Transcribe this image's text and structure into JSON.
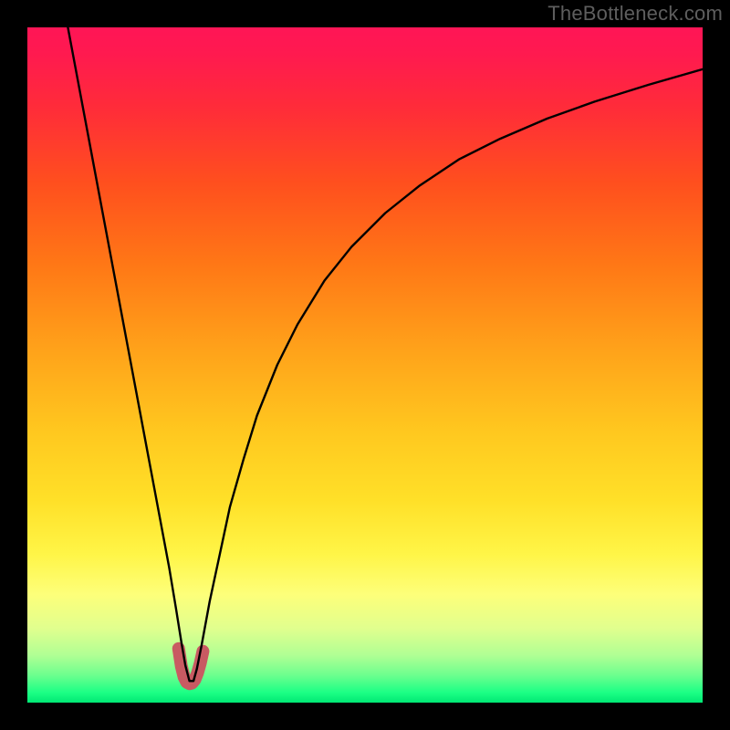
{
  "watermark": "TheBottleneck.com",
  "chart_data": {
    "type": "line",
    "title": "",
    "xlabel": "",
    "ylabel": "",
    "xlim": [
      0,
      100
    ],
    "ylim": [
      0,
      100
    ],
    "grid": false,
    "legend": null,
    "background_gradient_stops": [
      {
        "offset": 0.0,
        "color": "#ff1556"
      },
      {
        "offset": 0.04,
        "color": "#ff1a4f"
      },
      {
        "offset": 0.12,
        "color": "#ff2c39"
      },
      {
        "offset": 0.23,
        "color": "#ff4f1e"
      },
      {
        "offset": 0.35,
        "color": "#ff7716"
      },
      {
        "offset": 0.48,
        "color": "#ffa31a"
      },
      {
        "offset": 0.6,
        "color": "#ffc81f"
      },
      {
        "offset": 0.7,
        "color": "#ffe028"
      },
      {
        "offset": 0.78,
        "color": "#fff547"
      },
      {
        "offset": 0.84,
        "color": "#fdff7a"
      },
      {
        "offset": 0.89,
        "color": "#e1ff8e"
      },
      {
        "offset": 0.93,
        "color": "#b0ff94"
      },
      {
        "offset": 0.96,
        "color": "#6bff8e"
      },
      {
        "offset": 0.985,
        "color": "#1cff85"
      },
      {
        "offset": 1.0,
        "color": "#00e874"
      }
    ],
    "primary_curve_x": [
      6.0,
      7.5,
      9.0,
      10.5,
      12.0,
      13.5,
      15.0,
      16.5,
      18.0,
      19.5,
      21.0,
      22.0,
      22.8,
      23.4,
      24.0,
      24.6,
      25.1,
      25.8,
      27.0,
      28.5,
      30.0,
      32.0,
      34.0,
      37.0,
      40.0,
      44.0,
      48.0,
      53.0,
      58.0,
      64.0,
      70.0,
      77.0,
      84.0,
      92.0,
      100.0
    ],
    "primary_curve_y": [
      100.0,
      92.0,
      84.0,
      76.0,
      68.0,
      60.0,
      52.0,
      44.0,
      36.0,
      28.0,
      20.0,
      14.0,
      9.0,
      5.5,
      3.2,
      3.2,
      5.0,
      8.5,
      15.0,
      22.0,
      29.0,
      36.0,
      42.5,
      50.0,
      56.0,
      62.5,
      67.5,
      72.5,
      76.5,
      80.5,
      83.5,
      86.5,
      89.0,
      91.5,
      93.8
    ],
    "marker_curve_x": [
      22.4,
      22.8,
      23.2,
      23.6,
      24.0,
      24.4,
      24.8,
      25.2,
      25.6,
      26.0
    ],
    "marker_curve_y": [
      8.0,
      5.4,
      3.8,
      3.0,
      2.8,
      2.9,
      3.4,
      4.4,
      5.8,
      7.6
    ],
    "marker_color": "#c85a62"
  }
}
